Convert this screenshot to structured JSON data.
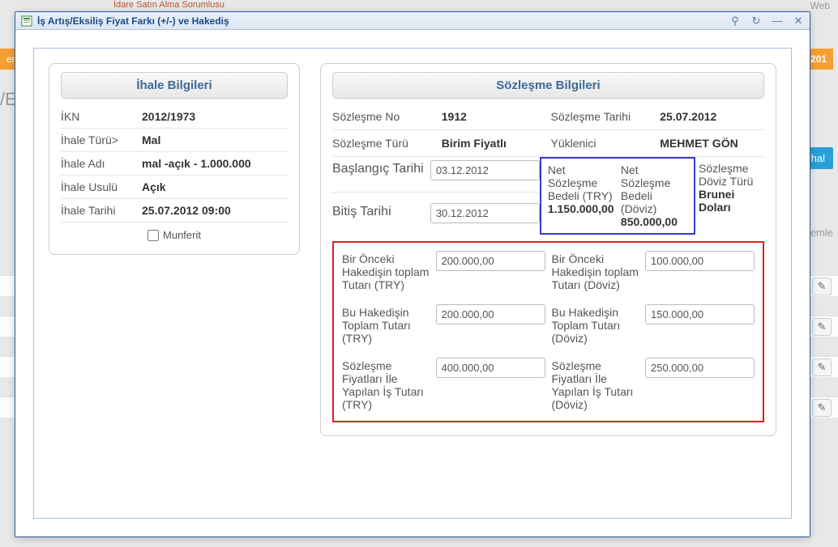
{
  "bg": {
    "subtitle": "İdare Satın Alma Sorumlusu",
    "rightText": "Web",
    "tabText": "enl",
    "year": "201",
    "btnText": "İhal",
    "emlText": "emle",
    "slash": "/E"
  },
  "modal": {
    "title": "İş Artış/Eksiliş Fiyat Farkı (+/-) ve Hakediş"
  },
  "ihale": {
    "header": "İhale Bilgileri",
    "ikn_label": "İKN",
    "ikn_value": "2012/1973",
    "turu_label": "İhale Türü>",
    "turu_value": "Mal",
    "adi_label": "İhale Adı",
    "adi_value": "mal -açık - 1.000.000",
    "usulu_label": "İhale Usulü",
    "usulu_value": "Açık",
    "tarihi_label": "İhale Tarihi",
    "tarihi_value": "25.07.2012 09:00",
    "munferit_label": "Munferit"
  },
  "sozlesme": {
    "header": "Sözleşme Bilgileri",
    "no_label": "Sözleşme No",
    "no_value": "1912",
    "tarih_label": "Sözleşme Tarihi",
    "tarih_value": "25.07.2012",
    "turu_label": "Sözleşme Türü",
    "turu_value": "Birim Fiyatlı",
    "yuklenici_label": "Yüklenici",
    "yuklenici_value": "MEHMET GÖN",
    "baslangic_label": "Başlangıç Tarihi",
    "baslangic_value": "03.12.2012",
    "bitis_label": "Bitiş Tarihi",
    "bitis_value": "30.12.2012",
    "net_try_label": "Net Sözleşme Bedeli (TRY)",
    "net_try_value": "1.150.000,00",
    "net_doviz_label": "Net Sözleşme Bedeli (Döviz)",
    "net_doviz_value": "850.000,00",
    "doviz_turu_label": "Sözleşme Döviz Türü",
    "doviz_turu_value": "Brunei Doları"
  },
  "hakedis": {
    "onceki_try_label": "Bir Önceki Hakedişin toplam Tutarı (TRY)",
    "onceki_try_value": "200.000,00",
    "onceki_doviz_label": "Bir Önceki Hakedişin toplam Tutarı (Döviz)",
    "onceki_doviz_value": "100.000,00",
    "bu_try_label": "Bu Hakedişin Toplam Tutarı (TRY)",
    "bu_try_value": "200.000,00",
    "bu_doviz_label": "Bu Hakedişin Toplam Tutarı (Döviz)",
    "bu_doviz_value": "150.000,00",
    "fiyat_try_label": "Sözleşme Fiyatları İle Yapılan İş Tutarı (TRY)",
    "fiyat_try_value": "400.000,00",
    "fiyat_doviz_label": "Sözleşme Fiyatları İle Yapılan İş Tutarı (Döviz)",
    "fiyat_doviz_value": "250.000,00"
  }
}
